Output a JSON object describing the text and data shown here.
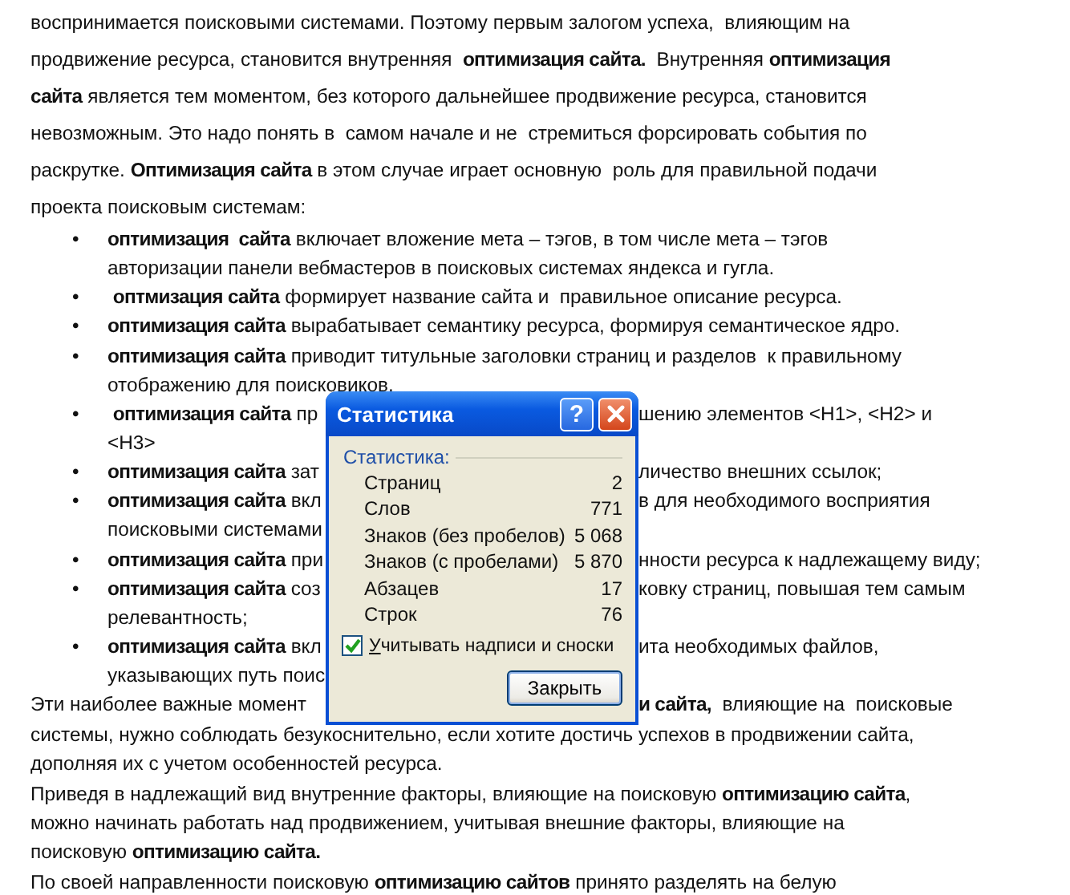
{
  "document": {
    "lines": [
      {
        "kind": "para",
        "left": "воспринимается поисковыми системами. Поэтому первым залогом успеха,  влияющим на"
      },
      {
        "kind": "para",
        "left": "продвижение ресурса, становится внутренняя  **оптимизация сайта.**  Внутренняя **оптимизация**"
      },
      {
        "kind": "para",
        "left": "**сайта** является тем моментом, без которого дальнейшее продвижение ресурса, становится"
      },
      {
        "kind": "para",
        "left": "невозможным. Это надо понять в  самом начале и не  стремиться форсировать события по"
      },
      {
        "kind": "para",
        "left": "раскрутке. **Оптимизация сайта** в этом случае играет основную  роль для правильной подачи"
      },
      {
        "kind": "para",
        "left": "проекта поисковым системам:"
      },
      {
        "kind": "bullet",
        "marker": "•",
        "left": "**оптимизация  сайта** включает вложение мета – тэгов, в том числе мета – тэгов"
      },
      {
        "kind": "cont",
        "left": "авторизации панели вебмастеров в поисковых системах яндекса и гугла."
      },
      {
        "kind": "bullet",
        "marker": "•",
        "left": " **оптмизация сайта** формирует название сайта и  правильное описание ресурса."
      },
      {
        "kind": "bullet",
        "marker": "•",
        "left": "**оптимизация сайта** вырабатывает семантику ресурса, формируя семантическое ядро."
      },
      {
        "kind": "bullet",
        "marker": "•",
        "left": "**оптимизация сайта** приводит титульные заголовки страниц и разделов  к правильному"
      },
      {
        "kind": "cont",
        "left": "отображению для поисковиков."
      },
      {
        "kind": "bullet",
        "marker": "•",
        "left": " **оптимизация сайта** пр",
        "right": "шению элементов <H1>, <H2> и"
      },
      {
        "kind": "cont",
        "left": "<H3>"
      },
      {
        "kind": "bullet",
        "marker": "•",
        "left": "**оптимизация сайта** зат",
        "right": "личество внешних ссылок;"
      },
      {
        "kind": "bullet",
        "marker": "•",
        "left": "**оптимизация сайта** вкл",
        "right": "в для необходимого восприятия"
      },
      {
        "kind": "cont",
        "left": "поисковыми системами"
      },
      {
        "kind": "bullet",
        "marker": "•",
        "left": "**оптимизация сайта** при",
        "right": "нности ресурса к надлежащему виду;"
      },
      {
        "kind": "bullet",
        "marker": "•",
        "left": "**оптимизация сайта** соз",
        "right": "ковку страниц, повышая тем самым"
      },
      {
        "kind": "cont",
        "left": "релевантность;"
      },
      {
        "kind": "bullet",
        "marker": "•",
        "left": "**оптимизация сайта** вкл",
        "right": "ита необходимых файлов,"
      },
      {
        "kind": "cont",
        "left": "указывающих путь поис"
      },
      {
        "kind": "para",
        "left": "Эти наиболее важные момент",
        "right": "**и сайта,**  влияющие на  поисковые"
      },
      {
        "kind": "para",
        "left": "системы, нужно соблюдать безукоснительно, если хотите достичь успехов в продвижении сайта,"
      },
      {
        "kind": "para",
        "left": "дополняя их с учетом особенностей ресурса."
      },
      {
        "kind": "para",
        "left": "Приведя в надлежащий вид внутренние факторы, влияющие на поисковую **оптимизацию сайта**,"
      },
      {
        "kind": "para",
        "left": "можно начинать работать над продвижением, учитывая внешние факторы, влияющие на"
      },
      {
        "kind": "para",
        "left": "поисковую **оптимизацию сайта.**"
      },
      {
        "kind": "para",
        "left": "По своей направленности поисковую **оптимизацию сайтов** принято разделять на белую"
      }
    ]
  },
  "dialog": {
    "title": "Статистика",
    "help": "?",
    "group_label": "Статистика:",
    "stats": [
      {
        "label": "Страниц",
        "value": "2"
      },
      {
        "label": "Слов",
        "value": "771"
      },
      {
        "label": "Знаков (без пробелов)",
        "value": "5 068"
      },
      {
        "label": "Знаков (с пробелами)",
        "value": "5 870"
      },
      {
        "label": "Абзацев",
        "value": "17"
      },
      {
        "label": "Строк",
        "value": "76"
      }
    ],
    "checkbox": {
      "label": "Учитывать надписи и сноски",
      "checked": true
    },
    "button": "Закрыть"
  }
}
